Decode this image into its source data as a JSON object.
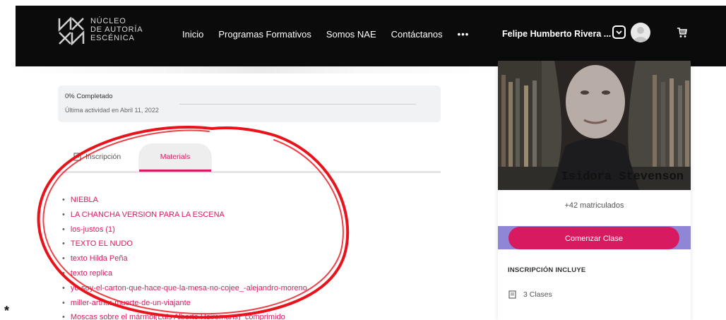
{
  "brand": {
    "logo_lines": [
      "NÚCLEO",
      "DE AUTORÍA",
      "ESCÉNICA"
    ]
  },
  "nav": {
    "links": [
      "Inicio",
      "Programas Formativos",
      "Somos NAE",
      "Contáctanos"
    ],
    "more": "•••",
    "user_name": "Felipe Humberto Rivera ..."
  },
  "progress": {
    "title": "0% Completado",
    "last_activity": "Última actividad en Abril 11, 2022",
    "percent": 0
  },
  "tabs": [
    {
      "label": "Inscripción",
      "icon": "book-icon",
      "active": false
    },
    {
      "label": "Materials",
      "active": true
    }
  ],
  "materials": [
    "NIEBLA",
    "LA CHANCHA VERSION PARA LA ESCENA",
    "los-justos (1)",
    "TEXTO EL NUDO",
    "texto Hilda Peña",
    "texto replica",
    "yo-soy-el-carton-que-hace-que-la-mesa-no-cojee_-alejandro-moreno",
    "miller-arthur-muerte-de-un-viajante",
    "Moscas sobre el mármol(Luis Alberto Heiremans)_comprimido"
  ],
  "sidebar": {
    "instructor_name": "Isidora Stevenson",
    "enrolled": "+42 matriculados",
    "start_button": "Comenzar Clase",
    "includes_title": "INSCRIPCIÓN INCLUYE",
    "classes": "3 Clases"
  },
  "marker": "*",
  "colors": {
    "accent": "#d81b60",
    "navbar": "#0b0b0b",
    "name_band": "#8f86d6",
    "annotation": "#e8131b"
  }
}
